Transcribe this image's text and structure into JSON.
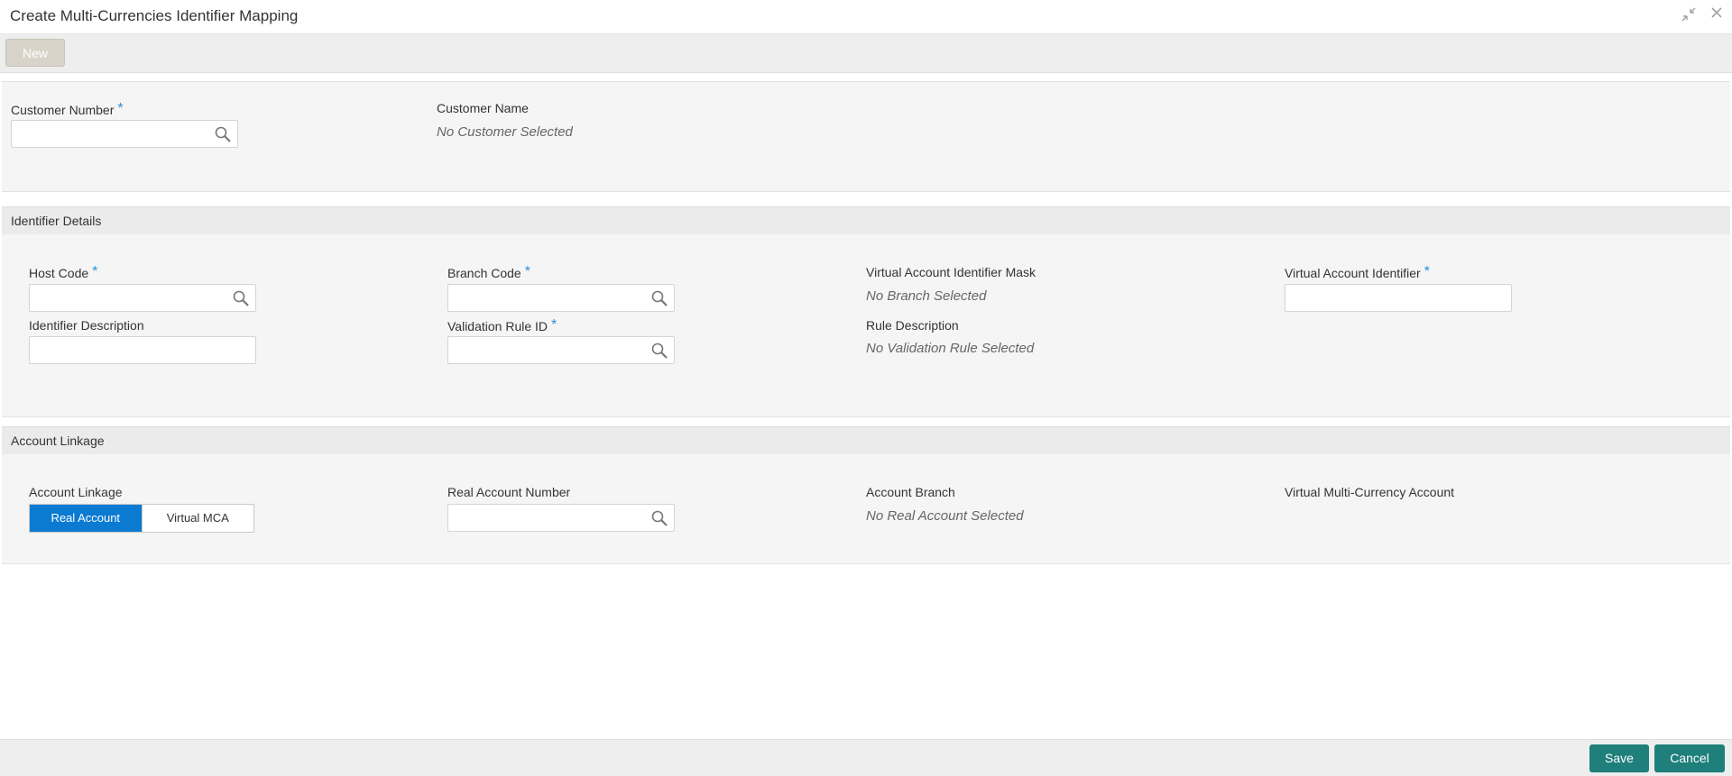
{
  "window": {
    "title": "Create Multi-Currencies Identifier Mapping",
    "icons": [
      "collapse-icon",
      "close-icon"
    ]
  },
  "toolbar": {
    "new_label": "New"
  },
  "customer": {
    "number_label": "Customer Number",
    "number_value": "",
    "name_label": "Customer Name",
    "name_value": "No Customer Selected"
  },
  "identifier": {
    "section_title": "Identifier Details",
    "host_code_label": "Host Code",
    "host_code_value": "",
    "branch_code_label": "Branch Code",
    "branch_code_value": "",
    "mask_label": "Virtual Account Identifier Mask",
    "mask_value": "No Branch Selected",
    "vai_label": "Virtual Account Identifier",
    "vai_value": "",
    "desc_label": "Identifier Description",
    "desc_value": "",
    "rule_id_label": "Validation Rule ID",
    "rule_id_value": "",
    "rule_desc_label": "Rule Description",
    "rule_desc_value": "No Validation Rule Selected"
  },
  "linkage": {
    "section_title": "Account Linkage",
    "linkage_label": "Account Linkage",
    "options": [
      "Real Account",
      "Virtual MCA"
    ],
    "selected": "Real Account",
    "real_account_label": "Real Account Number",
    "real_account_value": "",
    "branch_label": "Account Branch",
    "branch_value": "No Real Account Selected",
    "vmca_label": "Virtual Multi-Currency Account"
  },
  "required_marker": "*",
  "footer": {
    "save_label": "Save",
    "cancel_label": "Cancel"
  },
  "colors": {
    "accent_blue": "#0a7bd1",
    "required_marker": "#2a8fd6",
    "footer_button": "#1f7f7a",
    "new_button": "#d8d4ca"
  }
}
